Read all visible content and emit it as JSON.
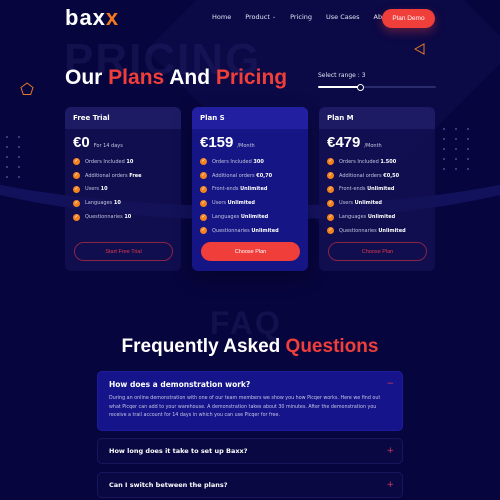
{
  "brand": {
    "logo_main": "bax",
    "logo_accent": "x",
    "accent_color": "#f03e3a",
    "logo_accent_color": "#f47a1f"
  },
  "nav": {
    "items": [
      {
        "label": "Home",
        "has_dropdown": false
      },
      {
        "label": "Product",
        "has_dropdown": true
      },
      {
        "label": "Pricing",
        "has_dropdown": false
      },
      {
        "label": "Use Cases",
        "has_dropdown": false
      },
      {
        "label": "About Us",
        "has_dropdown": true
      }
    ],
    "cta": "Plan Demo"
  },
  "hero": {
    "ghost_text": "PRICING",
    "title_parts": [
      "Our ",
      "Plans",
      " And ",
      "Pricing"
    ]
  },
  "range": {
    "label": "Select range : 3",
    "value": 3,
    "fill_fraction": 0.36
  },
  "plans": [
    {
      "name": "Free Trial",
      "price": "€0",
      "period": "For 14 days",
      "features": [
        {
          "text": "Orders Included",
          "value": "10"
        },
        {
          "text": "Additional orders",
          "value": "Free"
        },
        {
          "text": "Users",
          "value": "10"
        },
        {
          "text": "Languages",
          "value": "10"
        },
        {
          "text": "Questionnaries",
          "value": "10"
        }
      ],
      "cta": "Start Free Trial"
    },
    {
      "name": "Plan S",
      "price": "€159",
      "period": "/Month",
      "features": [
        {
          "text": "Orders Included",
          "value": "300"
        },
        {
          "text": "Additional orders",
          "value": "€0,70"
        },
        {
          "text": "Front-ends",
          "value": "Unlimited"
        },
        {
          "text": "Users",
          "value": "Unlimited"
        },
        {
          "text": "Languages",
          "value": "Unlimited"
        },
        {
          "text": "Questionnaries",
          "value": "Unlimited"
        }
      ],
      "cta": "Choose Plan"
    },
    {
      "name": "Plan M",
      "price": "€479",
      "period": "/Month",
      "features": [
        {
          "text": "Orders Included",
          "value": "1.500"
        },
        {
          "text": "Additional orders",
          "value": "€0,50"
        },
        {
          "text": "Front-ends",
          "value": "Unlimited"
        },
        {
          "text": "Users",
          "value": "Unlimited"
        },
        {
          "text": "Languages",
          "value": "Unlimited"
        },
        {
          "text": "Questionnaries",
          "value": "Unlimited"
        }
      ],
      "cta": "Choose Plan"
    }
  ],
  "faq": {
    "ghost_text": "FAQ",
    "title_parts": [
      "Frequently Asked ",
      "Questions"
    ],
    "items": [
      {
        "question": "How does a demonstration work?",
        "answer": "During an online demonstration with one of our team members we show you how Picqer works. Here we find out what Picqer can add to your warehouse. A demonstration takes about 30 minutes. After the demonstration you receive a trail account for 14 days in which you can use Picqer for free.",
        "open": true,
        "toggle": "−"
      },
      {
        "question": "How long does it take to set up Baxx?",
        "open": false,
        "toggle": "+"
      },
      {
        "question": "Can I switch between the plans?",
        "open": false,
        "toggle": "+"
      }
    ]
  }
}
